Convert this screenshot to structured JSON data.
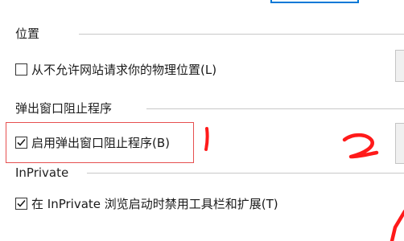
{
  "sections": {
    "location": {
      "title": "位置",
      "checkbox_label": "从不允许网站请求你的物理位置(L)",
      "checked": false
    },
    "popup": {
      "title": "弹出窗口阻止程序",
      "checkbox_label": "启用弹出窗口阻止程序(B)",
      "checked": true
    },
    "inprivate": {
      "title": "InPrivate",
      "checkbox_label": "在 InPrivate 浏览启动时禁用工具栏和扩展(T)",
      "checked": true
    }
  },
  "annotations": {
    "color": "#ff1a1a",
    "markers": [
      "1",
      "2"
    ]
  }
}
